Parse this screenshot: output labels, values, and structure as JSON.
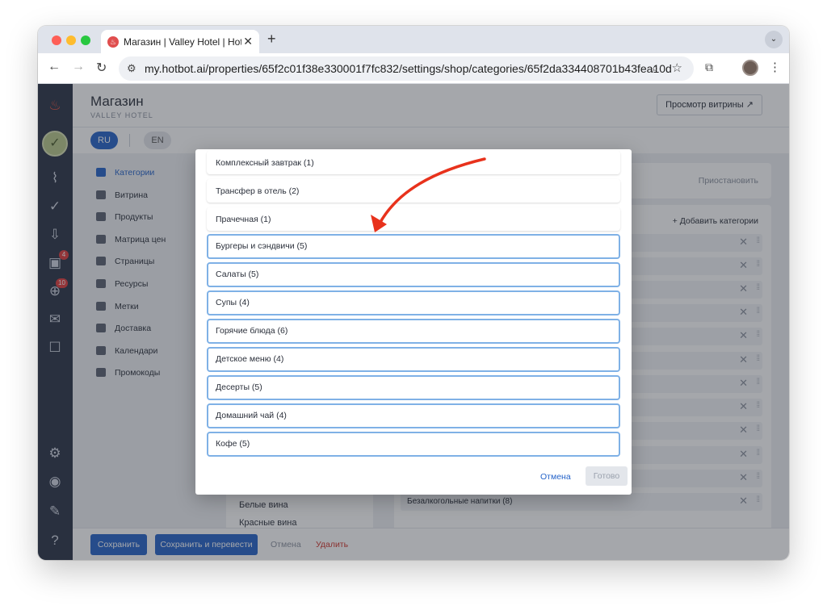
{
  "browser": {
    "tab_title": "Магазин | Valley Hotel | Hotbot",
    "url": "my.hotbot.ai/properties/65f2c01f38e330001f7fc832/settings/shop/categories/65f2da334408701b43fea10d"
  },
  "sidebar_badges": {
    "badge_1": "4",
    "badge_2": "10"
  },
  "header": {
    "title": "Магазин",
    "subtitle": "VALLEY HOTEL",
    "preview_button": "Просмотр витрины ↗"
  },
  "languages": {
    "ru": "RU",
    "en": "EN"
  },
  "sidenav": [
    {
      "label": "Категории"
    },
    {
      "label": "Витрина"
    },
    {
      "label": "Продукты"
    },
    {
      "label": "Матрица цен"
    },
    {
      "label": "Страницы"
    },
    {
      "label": "Ресурсы"
    },
    {
      "label": "Метки"
    },
    {
      "label": "Доставка"
    },
    {
      "label": "Календари"
    },
    {
      "label": "Промокоды"
    }
  ],
  "right_panel": {
    "pause": "Приостановить",
    "add_category": "Добавить категории",
    "last_row": "Безалкогольные напитки (8)"
  },
  "mid_list": {
    "item_1": "Белые вина",
    "item_2": "Красные вина"
  },
  "footer": {
    "save": "Сохранить",
    "save_translate": "Сохранить и перевести",
    "cancel": "Отмена",
    "delete": "Удалить"
  },
  "modal": {
    "items": [
      {
        "label": "Комплексный завтрак (1)",
        "selected": false
      },
      {
        "label": "Трансфер в отель (2)",
        "selected": false
      },
      {
        "label": "Прачечная (1)",
        "selected": false
      },
      {
        "label": "Бургеры и сэндвичи (5)",
        "selected": true
      },
      {
        "label": "Салаты (5)",
        "selected": true
      },
      {
        "label": "Супы (4)",
        "selected": true
      },
      {
        "label": "Горячие блюда (6)",
        "selected": true
      },
      {
        "label": "Детское меню (4)",
        "selected": true
      },
      {
        "label": "Десерты (5)",
        "selected": true
      },
      {
        "label": "Домашний чай (4)",
        "selected": true
      },
      {
        "label": "Кофе (5)",
        "selected": true
      }
    ],
    "cancel": "Отмена",
    "done": "Готово"
  },
  "colors": {
    "accent": "#2563c9",
    "selected_border": "#7fb1e6",
    "arrow": "#e8321c",
    "danger": "#d0342c"
  }
}
